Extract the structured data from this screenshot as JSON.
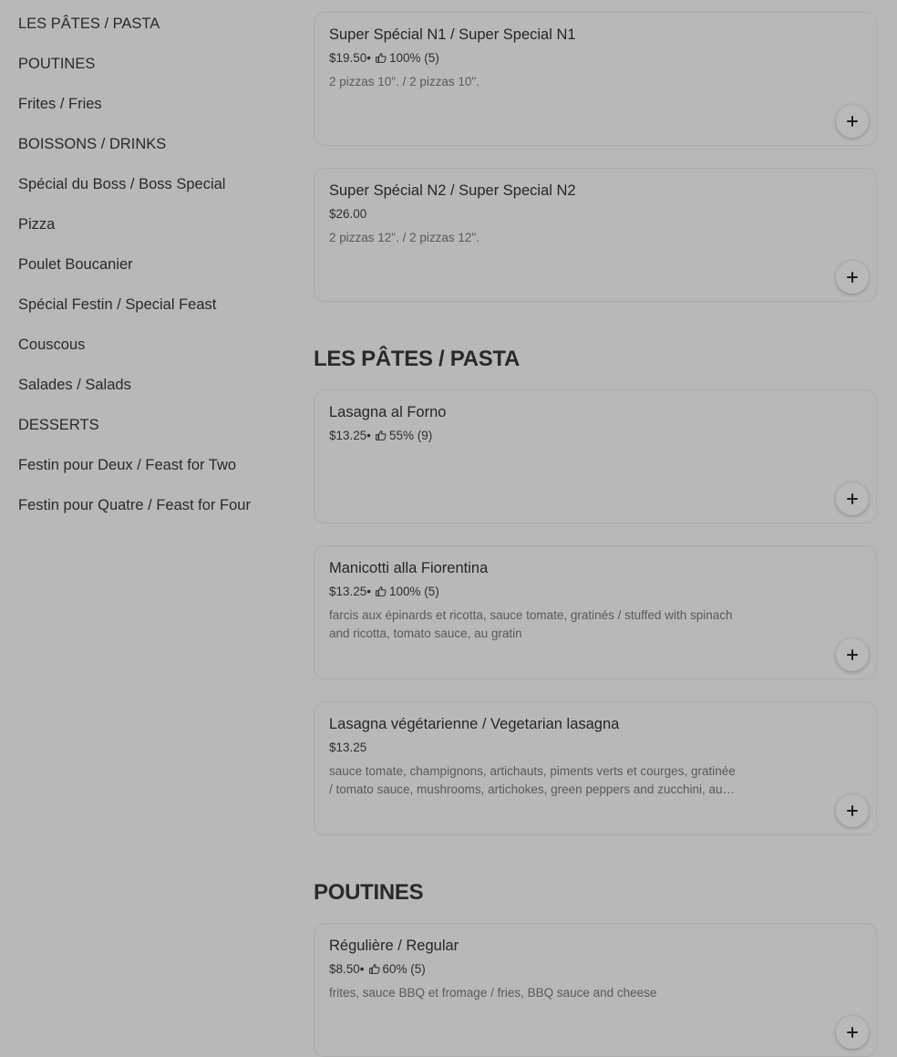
{
  "sidebar": {
    "items": [
      {
        "label": "LES PÂTES / PASTA"
      },
      {
        "label": "POUTINES"
      },
      {
        "label": "Frites / Fries"
      },
      {
        "label": "BOISSONS / DRINKS"
      },
      {
        "label": "Spécial du Boss / Boss Special"
      },
      {
        "label": "Pizza"
      },
      {
        "label": "Poulet Boucanier"
      },
      {
        "label": "Spécial Festin / Special Feast"
      },
      {
        "label": "Couscous"
      },
      {
        "label": "Salades / Salads"
      },
      {
        "label": "DESSERTS"
      },
      {
        "label": "Festin pour Deux / Feast for Two"
      },
      {
        "label": "Festin pour Quatre / Feast for Four"
      }
    ]
  },
  "cards": [
    {
      "name": "Super Spécial N1 / Super Special N1",
      "price": "$19.50",
      "rating": "100% (5)",
      "description": "2 pizzas 10\". / 2 pizzas 10\"."
    },
    {
      "name": "Super Spécial N2 / Super Special N2",
      "price": "$26.00",
      "rating": "",
      "description": "2 pizzas 12\". / 2 pizzas 12\"."
    },
    {
      "name": "Lasagna al Forno",
      "price": "$13.25",
      "rating": "55% (9)",
      "description": ""
    },
    {
      "name": "Manicotti alla Fiorentina",
      "price": "$13.25",
      "rating": "100% (5)",
      "description": "farcis aux épinards et ricotta, sauce tomate, gratinés / stuffed with spinach and ricotta, tomato sauce, au gratin"
    },
    {
      "name": "Lasagna végétarienne / Vegetarian lasagna",
      "price": "$13.25",
      "rating": "",
      "description": "sauce tomate, champignons, artichauts, piments verts et courges, gratinée / tomato sauce, mushrooms, artichokes, green peppers and zucchini, au gratin"
    },
    {
      "name": "Régulière / Regular",
      "price": "$8.50",
      "rating": "60% (5)",
      "description": "frites, sauce BBQ et fromage / fries, BBQ sauce and cheese"
    }
  ],
  "sections": {
    "pasta": "LES PÂTES / PASTA",
    "poutines": "POUTINES"
  },
  "meta": {
    "separator": " • ",
    "rating_icon": "thumbs-up-icon",
    "add_icon": "plus-icon"
  }
}
